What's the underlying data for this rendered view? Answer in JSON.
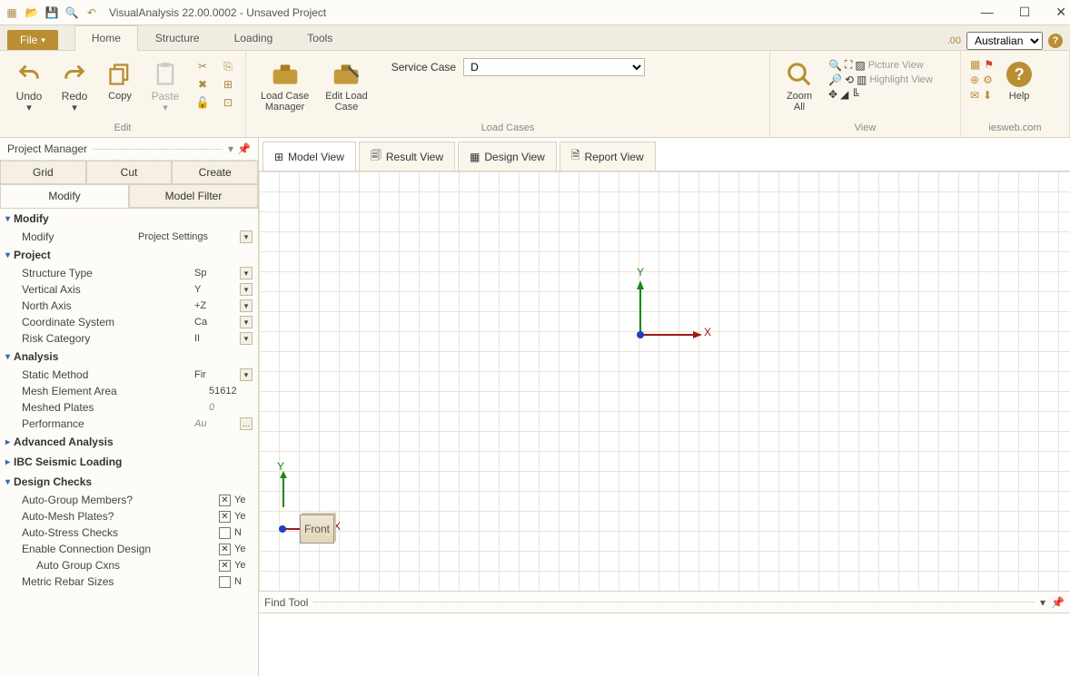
{
  "app": {
    "title": "VisualAnalysis 22.00.0002 - Unsaved Project"
  },
  "file_btn": "File",
  "tabs": {
    "home": "Home",
    "structure": "Structure",
    "loading": "Loading",
    "tools": "Tools"
  },
  "units_dropdown": "Australian",
  "ribbon": {
    "edit": {
      "undo": "Undo",
      "redo": "Redo",
      "copy": "Copy",
      "paste": "Paste",
      "label": "Edit"
    },
    "loadcases": {
      "manager": "Load Case\nManager",
      "editcase": "Edit Load\nCase",
      "service": "Service Case",
      "service_val": "D",
      "label": "Load Cases"
    },
    "view": {
      "zoomall": "Zoom\nAll",
      "picture": "Picture View",
      "highlight": "Highlight View",
      "label": "View"
    },
    "ies": {
      "help": "Help",
      "label": "iesweb.com"
    }
  },
  "pm": {
    "title": "Project Manager",
    "tabs": {
      "grid": "Grid",
      "cut": "Cut",
      "create": "Create",
      "modify": "Modify",
      "filter": "Model Filter"
    },
    "modify": {
      "hdr": "Modify",
      "row": {
        "k": "Modify",
        "v": "Project Settings"
      }
    },
    "project": {
      "hdr": "Project",
      "rows": [
        {
          "k": "Structure Type",
          "v": "Sp"
        },
        {
          "k": "Vertical Axis",
          "v": "Y"
        },
        {
          "k": "North Axis",
          "v": "+Z"
        },
        {
          "k": "Coordinate System",
          "v": "Ca"
        },
        {
          "k": "Risk Category",
          "v": "II"
        }
      ]
    },
    "analysis": {
      "hdr": "Analysis",
      "rows": [
        {
          "k": "Static Method",
          "v": "Fir",
          "dd": true
        },
        {
          "k": "Mesh Element Area",
          "v": "51612"
        },
        {
          "k": "Meshed Plates",
          "v": "0",
          "italic": true
        },
        {
          "k": "Performance",
          "v": "Au",
          "ell": true
        }
      ]
    },
    "adv": "Advanced Analysis",
    "ibc": "IBC Seismic Loading",
    "design": {
      "hdr": "Design Checks",
      "rows": [
        {
          "k": "Auto-Group Members?",
          "v": "Ye",
          "cb": true,
          "chk": true
        },
        {
          "k": "Auto-Mesh Plates?",
          "v": "Ye",
          "cb": true,
          "chk": true
        },
        {
          "k": "Auto-Stress Checks",
          "v": "N",
          "cb": true,
          "chk": false
        },
        {
          "k": "Enable Connection Design",
          "v": "Ye",
          "cb": true,
          "chk": true
        },
        {
          "k": "Auto Group Cxns",
          "v": "Ye",
          "cb": true,
          "chk": true,
          "indent": true
        },
        {
          "k": "Metric Rebar Sizes",
          "v": "N",
          "cb": true,
          "chk": false
        }
      ]
    }
  },
  "view_tabs": {
    "model": "Model View",
    "result": "Result View",
    "design": "Design View",
    "report": "Report View"
  },
  "axis": {
    "x": "X",
    "y": "Y"
  },
  "cube": "Front",
  "find": "Find Tool"
}
